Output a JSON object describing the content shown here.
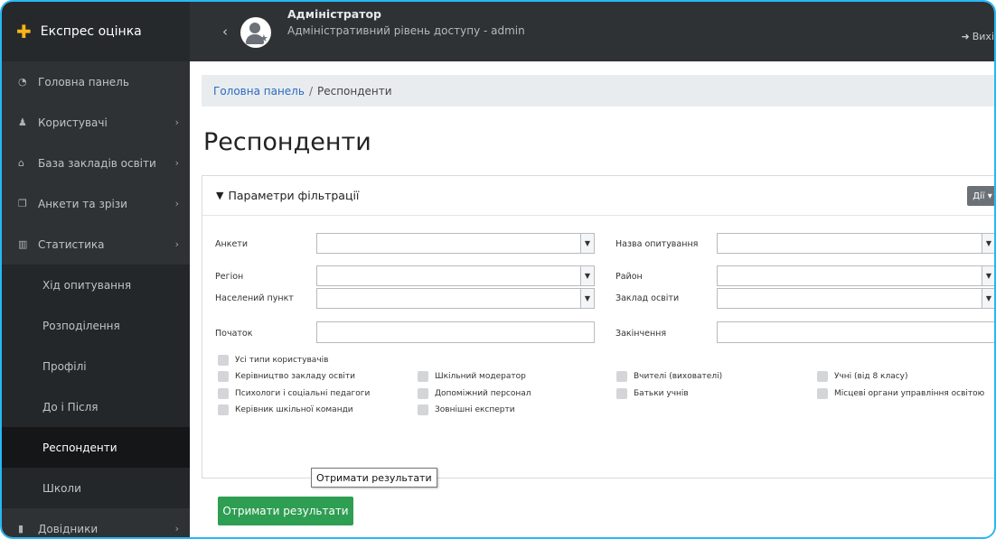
{
  "header": {
    "brand_title": "Експрес оцінка",
    "brand_icon": "puzzle-icon",
    "user_name": "Адміністратор",
    "user_role": "Адміністративний рівень доступу - admin",
    "logout_label": "Вихі"
  },
  "sidebar": {
    "items": [
      {
        "label": "Головна панель",
        "icon": "dashboard-icon"
      },
      {
        "label": "Користувачі",
        "icon": "user-icon"
      },
      {
        "label": "База закладів освіти",
        "icon": "institution-icon"
      },
      {
        "label": "Анкети та зрізи",
        "icon": "forms-icon"
      },
      {
        "label": "Статистика",
        "icon": "bar-chart-icon"
      }
    ],
    "sub_items": [
      {
        "label": "Хід опитування"
      },
      {
        "label": "Розподілення"
      },
      {
        "label": "Профілі"
      },
      {
        "label": "До і Після"
      },
      {
        "label": "Респонденти",
        "active": true
      },
      {
        "label": "Школи"
      }
    ],
    "bottom_item": {
      "label": "Довідники",
      "icon": "book-icon"
    }
  },
  "breadcrumb": {
    "home": "Головна панель",
    "separator": "/",
    "current": "Респонденти"
  },
  "page_title": "Респонденти",
  "filter_panel": {
    "title": "Параметри фільтрації",
    "actions_label": "Дії",
    "fields": {
      "questionnaires": {
        "label": "Анкети",
        "value": ""
      },
      "survey_name": {
        "label": "Назва опитування",
        "value": ""
      },
      "region": {
        "label": "Регіон",
        "value": ""
      },
      "district": {
        "label": "Район",
        "value": ""
      },
      "settlement": {
        "label": "Населений пункт",
        "value": ""
      },
      "institution": {
        "label": "Заклад освіти",
        "value": ""
      },
      "start": {
        "label": "Початок",
        "value": ""
      },
      "end": {
        "label": "Закінчення",
        "value": ""
      }
    },
    "all_user_types": "Усі типи користувачів",
    "user_types": [
      "Керівництво закладу освіти",
      "Шкільний модератор",
      "Вчителі (вихователі)",
      "Учні (від 8 класу)",
      "Психологи і соціальні педагоги",
      "Допоміжний персонал",
      "Батьки учнів",
      "Місцеві органи управління освітою",
      "Керівник шкільної команди",
      "Зовнішні експерти"
    ],
    "submit_label": "Отримати результати"
  },
  "tooltip": "Отримати результати",
  "colors": {
    "sidebar_bg": "#2f3235",
    "accent_green": "#2e9e52",
    "link_blue": "#2b6bbf",
    "frame_border": "#29b6f6"
  }
}
